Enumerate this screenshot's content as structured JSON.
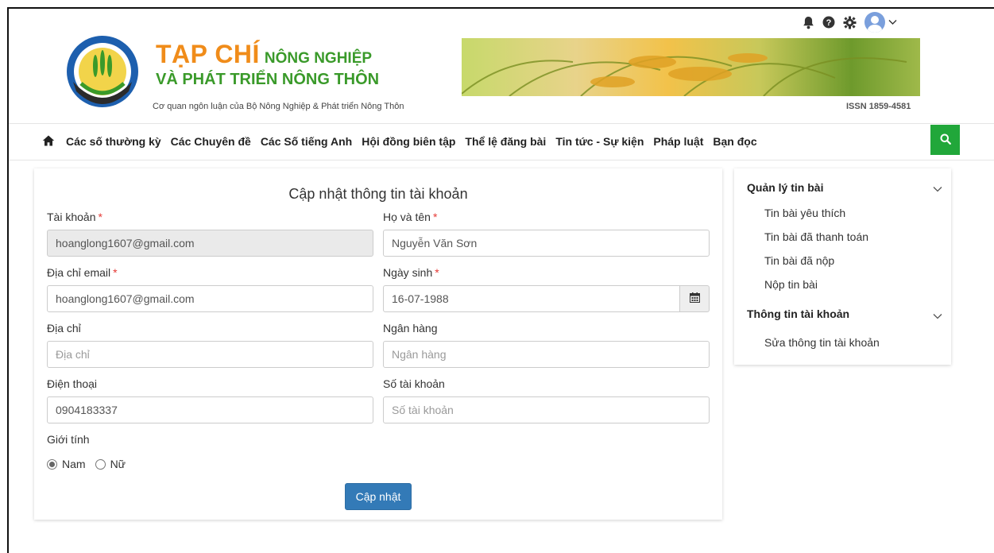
{
  "header": {
    "brand_big": "TẠP CHÍ",
    "brand_small": "NÔNG NGHIỆP",
    "brand_line2": "VÀ PHÁT TRIỂN NÔNG THÔN",
    "subtitle": "Cơ quan ngôn luận của Bộ Nông Nghiệp & Phát triển Nông Thôn",
    "issn": "ISSN 1859-4581",
    "logo_ring_text": "BỘ NÔNG NGHIỆP VÀ PHÁT TRIỂN NÔNG THÔN"
  },
  "top_icons": [
    "bell-icon",
    "help-icon",
    "gear-icon",
    "avatar",
    "chevron-down-icon"
  ],
  "nav": {
    "items": [
      "Các số thường kỳ",
      "Các Chuyên đề",
      "Các Số tiếng Anh",
      "Hội đồng biên tập",
      "Thể lệ đăng bài",
      "Tin tức - Sự kiện",
      "Pháp luật",
      "Bạn đọc"
    ]
  },
  "form": {
    "title": "Cập nhật thông tin tài khoản",
    "account_label": "Tài khoản",
    "account_value": "hoanglong1607@gmail.com",
    "fullname_label": "Họ và tên",
    "fullname_value": "Nguyễn Văn Sơn",
    "email_label": "Địa chỉ email",
    "email_value": "hoanglong1607@gmail.com",
    "dob_label": "Ngày sinh",
    "dob_value": "16-07-1988",
    "address_label": "Địa chỉ",
    "address_placeholder": "Địa chỉ",
    "bank_label": "Ngân hàng",
    "bank_placeholder": "Ngân hàng",
    "phone_label": "Điện thoại",
    "phone_value": "0904183337",
    "bank_account_label": "Số tài khoản",
    "bank_account_placeholder": "Số tài khoản",
    "required_mark": "*",
    "gender_label": "Giới tính",
    "gender_options": [
      "Nam",
      "Nữ"
    ],
    "gender_selected": "Nam",
    "submit_label": "Cập nhật"
  },
  "sidebar": {
    "section1_title": "Quản lý tin bài",
    "section1_items": [
      "Tin bài yêu thích",
      "Tin bài đã thanh toán",
      "Tin bài đã nộp",
      "Nộp tin bài"
    ],
    "section2_title": "Thông tin tài khoản",
    "section2_items": [
      "Sửa thông tin tài khoản"
    ]
  },
  "colors": {
    "brand_orange": "#f08c1a",
    "brand_green": "#3a9a2a",
    "search_green": "#21a73a",
    "primary_button": "#337ab7",
    "required_red": "#e53935"
  }
}
